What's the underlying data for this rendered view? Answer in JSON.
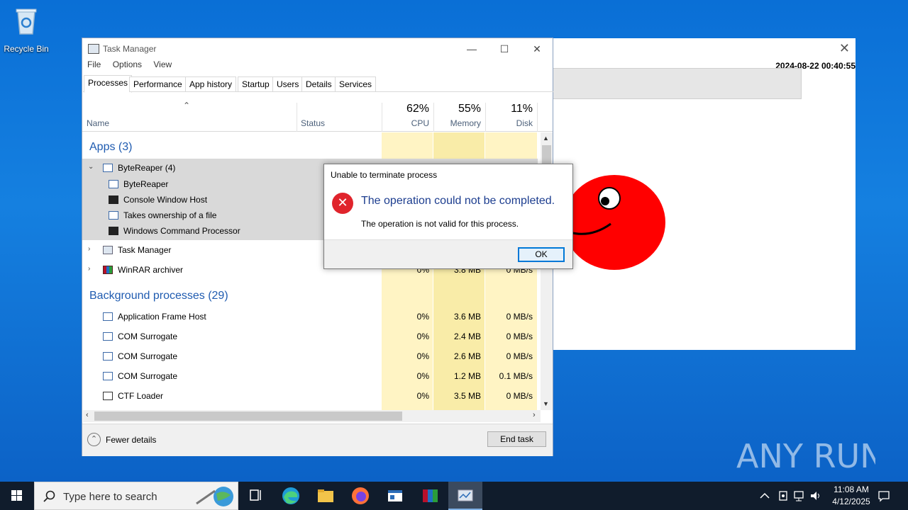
{
  "desktop": {
    "recycle_bin_label": "Recycle Bin"
  },
  "background_window": {
    "close_glyph": "✕",
    "timestamp": "2024-08-22 00:40:55"
  },
  "task_manager": {
    "title": "Task Manager",
    "menu": [
      "File",
      "Options",
      "View"
    ],
    "tabs": [
      "Processes",
      "Performance",
      "App history",
      "Startup",
      "Users",
      "Details",
      "Services"
    ],
    "active_tab": "Processes",
    "columns": {
      "name": "Name",
      "status": "Status",
      "cpu_pct": "62%",
      "cpu_label": "CPU",
      "mem_pct": "55%",
      "mem_label": "Memory",
      "disk_pct": "11%",
      "disk_label": "Disk"
    },
    "groups": {
      "apps": "Apps (3)",
      "background": "Background processes (29)"
    },
    "rows": {
      "byte_reaper": "ByteReaper (4)",
      "child1": "ByteReaper",
      "child2": "Console Window Host",
      "child3": "Takes ownership of a file",
      "child4": "Windows Command Processor",
      "task_manager": "Task Manager",
      "winrar": {
        "name": "WinRAR archiver",
        "cpu": "0%",
        "mem": "3.8 MB",
        "disk": "0 MB/s"
      },
      "bg": [
        {
          "name": "Application Frame Host",
          "cpu": "0%",
          "mem": "3.6 MB",
          "disk": "0 MB/s"
        },
        {
          "name": "COM Surrogate",
          "cpu": "0%",
          "mem": "2.4 MB",
          "disk": "0 MB/s"
        },
        {
          "name": "COM Surrogate",
          "cpu": "0%",
          "mem": "2.6 MB",
          "disk": "0 MB/s"
        },
        {
          "name": "COM Surrogate",
          "cpu": "0%",
          "mem": "1.2 MB",
          "disk": "0.1 MB/s"
        },
        {
          "name": "CTF Loader",
          "cpu": "0%",
          "mem": "3.5 MB",
          "disk": "0 MB/s"
        }
      ]
    },
    "fewer_details": "Fewer details",
    "end_task": "End task"
  },
  "dialog": {
    "title": "Unable to terminate process",
    "heading": "The operation could not be completed.",
    "message": "The operation is not valid for this process.",
    "ok": "OK"
  },
  "watermark": "ANY RUN",
  "taskbar": {
    "search_placeholder": "Type here to search",
    "time": "11:08 AM",
    "date": "4/12/2025"
  },
  "colors": {
    "desktop": "#0a6fd6",
    "heatmap_light": "#fff4c4",
    "heatmap_med": "#f9eca8",
    "dialog_heading": "#1c3d8f",
    "error": "#e0242c",
    "face": "#ff0000"
  }
}
